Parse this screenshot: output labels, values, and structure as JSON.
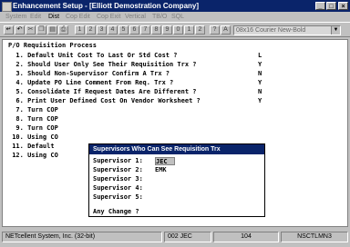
{
  "window": {
    "title": "Enhancement Setup - [Elliott Demostration Company]"
  },
  "menu": [
    "System",
    "Edit",
    "Dist",
    "Cop Edit",
    "Cop Exit",
    "Vertical",
    "TB/O",
    "SQL"
  ],
  "toolbar": {
    "font_select": "08x16 Courier New-Bold"
  },
  "screen": {
    "heading": "P/O Requisition Process",
    "rows": [
      {
        "text": "  1. Default Unit Cost To Last Or Std Cost ?",
        "value": "L"
      },
      {
        "text": "  2. Should User Only See Their Requisition Trx ?",
        "value": "Y"
      },
      {
        "text": "  3. Should Non-Supervisor Confirm A Trx ?",
        "value": "N"
      },
      {
        "text": "  4. Update PO Line Comment From Req. Trx ?",
        "value": "Y"
      },
      {
        "text": "  5. Consolidate If Request Dates Are Different ?",
        "value": "N"
      },
      {
        "text": "  6. Print User Defined Cost On Vendor Worksheet ?",
        "value": "Y"
      },
      {
        "text": "  7. Turn COP",
        "value": ""
      },
      {
        "text": "  8. Turn COP",
        "value": ""
      },
      {
        "text": "  9. Turn COP",
        "value": ""
      },
      {
        "text": " 10. Using CO",
        "value": ""
      },
      {
        "text": " 11. Default",
        "value": ""
      },
      {
        "text": " 12. Using CO",
        "value": ""
      }
    ]
  },
  "dialog": {
    "title": "Supervisors Who Can See Requisition Trx",
    "rows": [
      {
        "label": "Supervisor 1:",
        "value": "JEC"
      },
      {
        "label": "Supervisor 2:",
        "value": "EMK"
      },
      {
        "label": "Supervisor 3:",
        "value": ""
      },
      {
        "label": "Supervisor 4:",
        "value": ""
      },
      {
        "label": "Supervisor 5:",
        "value": ""
      }
    ],
    "prompt": "Any Change ?"
  },
  "status": {
    "system": "NETcellent System, Inc. (32-bit)",
    "company_user": "002 JEC",
    "number": "104",
    "program": "NSCTLMN3"
  }
}
